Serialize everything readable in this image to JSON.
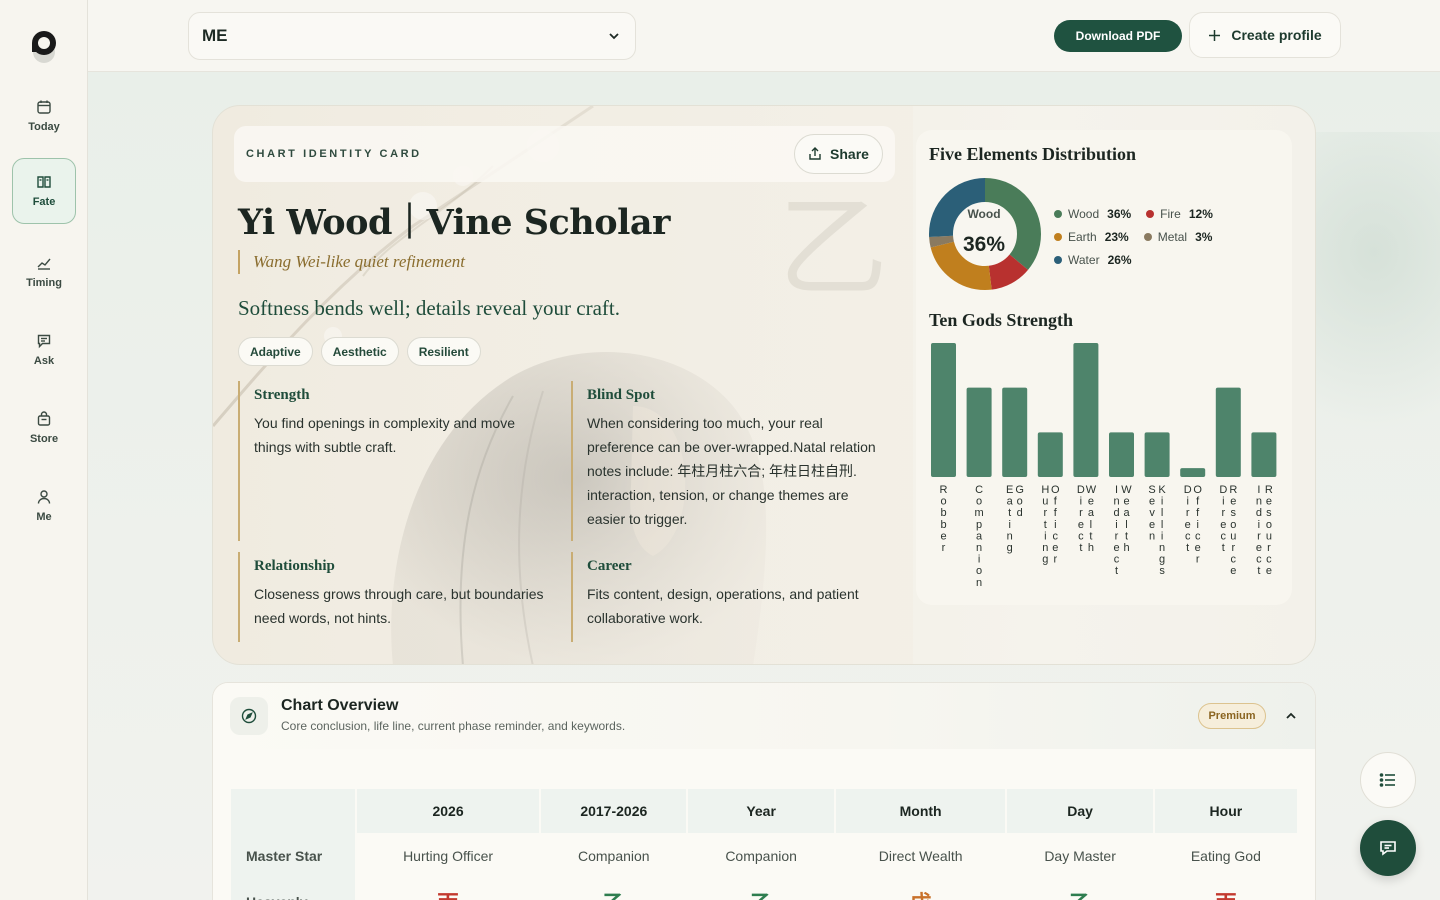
{
  "nav": {
    "items": [
      {
        "label": "Today",
        "icon": "calendar-icon"
      },
      {
        "label": "Fate",
        "icon": "book-icon",
        "active": true
      },
      {
        "label": "Timing",
        "icon": "trend-icon"
      },
      {
        "label": "Ask",
        "icon": "message-icon"
      },
      {
        "label": "Store",
        "icon": "bag-icon"
      },
      {
        "label": "Me",
        "icon": "user-icon"
      }
    ]
  },
  "topbar": {
    "profile_value": "ME",
    "download_label": "Download PDF",
    "create_label": "Create profile"
  },
  "card": {
    "eyebrow": "CHART IDENTITY CARD",
    "share_label": "Share",
    "title": "Yi Wood｜Vine Scholar",
    "subtitle": "Wang Wei-like quiet refinement",
    "motto": "Softness bends well; details reveal your craft.",
    "watermark_char": "乙",
    "tags": [
      "Adaptive",
      "Aesthetic",
      "Resilient"
    ],
    "traits": {
      "strength": {
        "title": "Strength",
        "body": "You find openings in complexity and move things with subtle craft."
      },
      "blind_spot": {
        "title": "Blind Spot",
        "body": "When considering too much, your real preference can be over-wrapped.Natal relation notes include: 年柱月柱六合; 年柱日柱自刑. interaction, tension, or change themes are easier to trigger."
      },
      "relationship": {
        "title": "Relationship",
        "body": "Closeness grows through care, but boundaries need words, not hints."
      },
      "career": {
        "title": "Career",
        "body": "Fits content, design, operations, and patient collaborative work."
      }
    }
  },
  "elements": {
    "title": "Five Elements Distribution",
    "center_label": "Wood",
    "center_value": "36%",
    "items": [
      {
        "name": "Wood",
        "pct": "36%",
        "value": 36,
        "color": "#4a7c59"
      },
      {
        "name": "Fire",
        "pct": "12%",
        "value": 12,
        "color": "#b8312f"
      },
      {
        "name": "Earth",
        "pct": "23%",
        "value": 23,
        "color": "#c07f1e"
      },
      {
        "name": "Metal",
        "pct": "3%",
        "value": 3,
        "color": "#8a7a60"
      },
      {
        "name": "Water",
        "pct": "26%",
        "value": 26,
        "color": "#2b5f78"
      }
    ]
  },
  "chart_data": {
    "type": "bar",
    "title": "Ten Gods Strength",
    "categories": [
      "Robber",
      "Companion",
      "Eating God",
      "Hurting Officer",
      "Direct Wealth",
      "Indirect Wealth",
      "Seven Killings",
      "Direct Officer",
      "Direct Resource",
      "Indirect Resource"
    ],
    "values": [
      3,
      2,
      2,
      1,
      3,
      1,
      1,
      0.2,
      2,
      1
    ],
    "ylim": [
      0,
      3
    ],
    "color": "#3f7a5f"
  },
  "overview": {
    "title": "Chart Overview",
    "desc": "Core conclusion, life line, current phase reminder, and keywords.",
    "badge": "Premium",
    "columns": [
      "2026",
      "2017-2026",
      "Year",
      "Month",
      "Day",
      "Hour"
    ],
    "rows": [
      {
        "label": "Master Star",
        "cells": [
          "Hurting Officer",
          "Companion",
          "Companion",
          "Direct Wealth",
          "Day Master",
          "Eating God"
        ]
      },
      {
        "label": "Heavenly",
        "cells": [
          "丙",
          "乙",
          "乙",
          "戊",
          "乙",
          "丙"
        ]
      }
    ]
  }
}
